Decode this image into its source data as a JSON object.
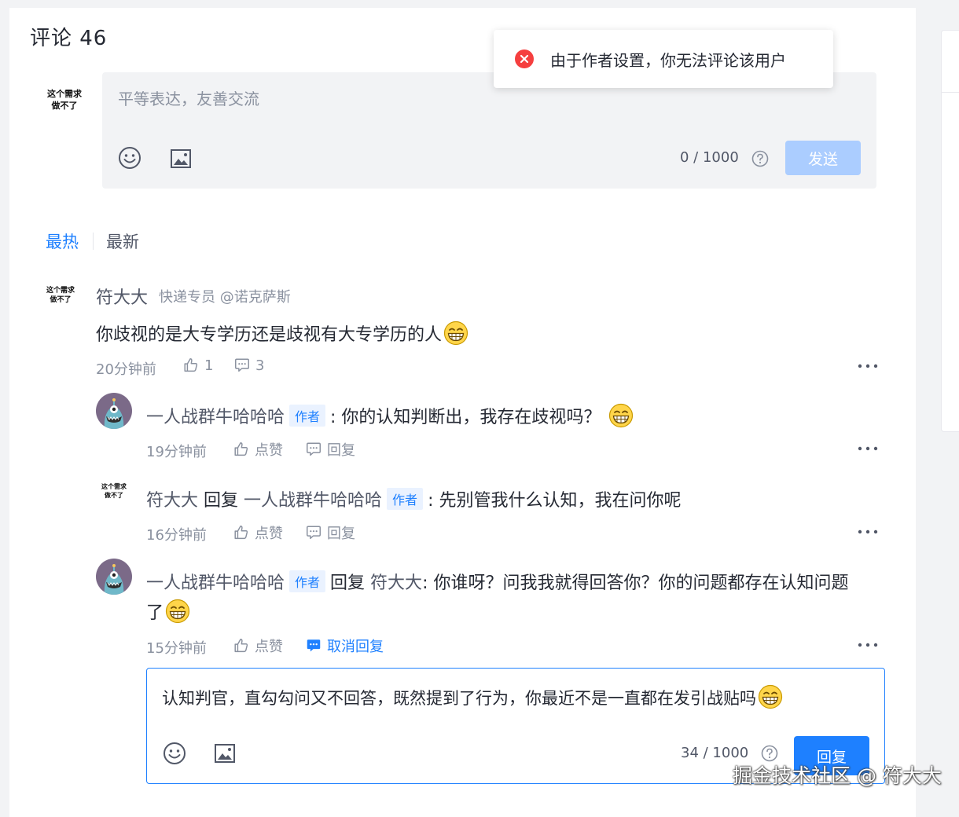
{
  "comments_header": {
    "title": "评论 46"
  },
  "current_user_avatar": {
    "line1": "这个需求",
    "line2": "做不了"
  },
  "editor": {
    "placeholder": "平等表达，友善交流",
    "counter": "0 / 1000",
    "send_label": "发送"
  },
  "toast": {
    "message": "由于作者设置，你无法评论该用户",
    "icon": "error-circle-icon",
    "color": "#f53f3f"
  },
  "tabs": [
    {
      "label": "最热",
      "active": true
    },
    {
      "label": "最新",
      "active": false
    }
  ],
  "comment": {
    "avatar": {
      "line1": "这个需求",
      "line2": "做不了"
    },
    "author": "符大大",
    "author_title": "快递专员 @诺克萨斯",
    "content": "你歧视的是大专学历还是歧视有大专学历的人",
    "time": "20分钟前",
    "likes": "1",
    "replies_count": "3"
  },
  "replies": [
    {
      "author": "一人战群牛哈哈哈",
      "tag": "作者",
      "content": ": 你的认知判断出，我存在歧视吗？",
      "time": "19分钟前",
      "like_label": "点赞",
      "reply_label": "回复"
    },
    {
      "avatar": {
        "line1": "这个需求",
        "line2": "做不了"
      },
      "author": "符大大",
      "reply_word": "回复",
      "reply_to": "一人战群牛哈哈哈",
      "tag": "作者",
      "content": ": 先别管我什么认知，我在问你呢",
      "time": "16分钟前",
      "like_label": "点赞",
      "reply_label": "回复"
    },
    {
      "author": "一人战群牛哈哈哈",
      "tag": "作者",
      "reply_word": "回复",
      "reply_to": "符大大",
      "content": ": 你谁呀？问我我就得回答你？你的问题都存在认知问题",
      "content_line2": "了",
      "time": "15分钟前",
      "like_label": "点赞",
      "reply_label": "取消回复"
    }
  ],
  "reply_editor": {
    "text": "认知判官，直勾勾问又不回答，既然提到了行为，你最近不是一直都在发引战贴吗",
    "counter": "34 / 1000",
    "submit_label": "回复"
  },
  "watermark": "掘金技术社区 @ 符大大",
  "colors": {
    "accent": "#1e80ff",
    "send_disabled": "#abcdff",
    "error": "#f53f3f"
  }
}
